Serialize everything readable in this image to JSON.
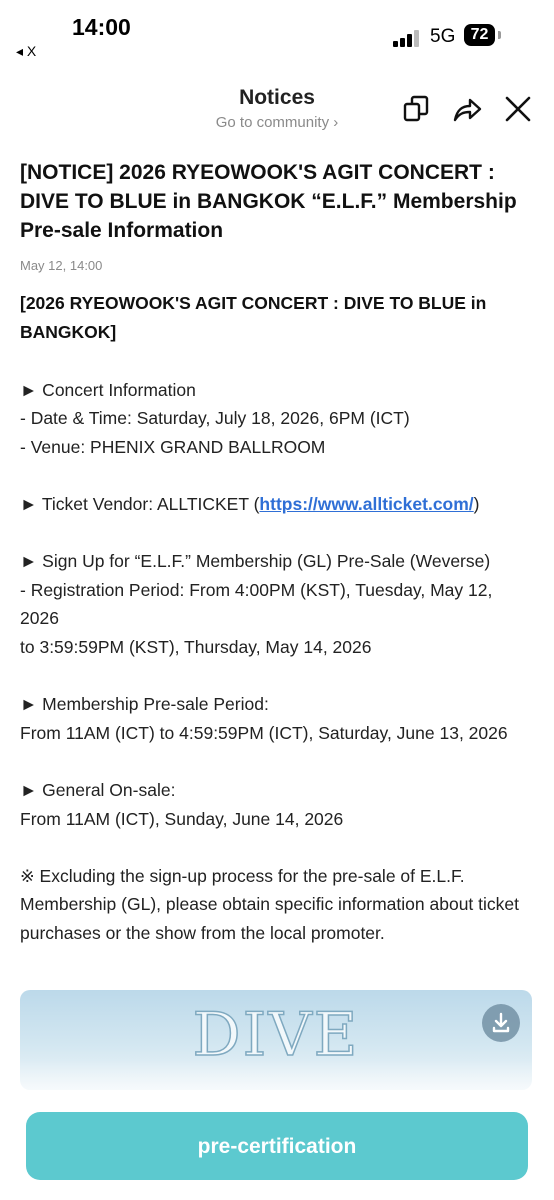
{
  "status_bar": {
    "time": "14:00",
    "back_label": "◂ X",
    "network": "5G",
    "battery": "72"
  },
  "header": {
    "title": "Notices",
    "subtitle": "Go to community ›"
  },
  "notice": {
    "title": "[NOTICE] 2026 RYEOWOOK'S AGIT CONCERT : DIVE TO BLUE in BANGKOK “E.L.F.” Membership Pre-sale Information",
    "date": "May 12, 14:00",
    "body_heading": "[2026 RYEOWOOK'S AGIT CONCERT : DIVE TO BLUE in BANGKOK]",
    "lines": [
      "",
      "► Concert Information",
      "- Date & Time: Saturday, July 18, 2026, 6PM (ICT)",
      "- Venue: PHENIX GRAND BALLROOM",
      "",
      "",
      "",
      "► Sign Up for “E.L.F.” Membership (GL) Pre-Sale (Weverse)",
      "- Registration Period: From 4:00PM (KST), Tuesday, May 12, 2026",
      "to 3:59:59PM (KST), Thursday, May 14, 2026",
      "",
      "► Membership Pre-sale Period:",
      "From 11AM (ICT) to 4:59:59PM (ICT), Saturday, June 13, 2026",
      "",
      "► General On-sale:",
      "From 11AM (ICT), Sunday, June 14, 2026",
      "",
      "※ Excluding the sign-up process for the pre-sale of E.L.F. Membership (GL), please obtain specific information about ticket purchases or the show from the local promoter."
    ],
    "vendor_prefix": "► Ticket Vendor: ALLTICKET (",
    "vendor_link": "https://www.allticket.com/",
    "vendor_suffix": ")"
  },
  "poster": {
    "text": "DIVE"
  },
  "cta": {
    "label": "pre-certification"
  },
  "colors": {
    "accent": "#5cc9cf",
    "link": "#2f6fd6"
  }
}
